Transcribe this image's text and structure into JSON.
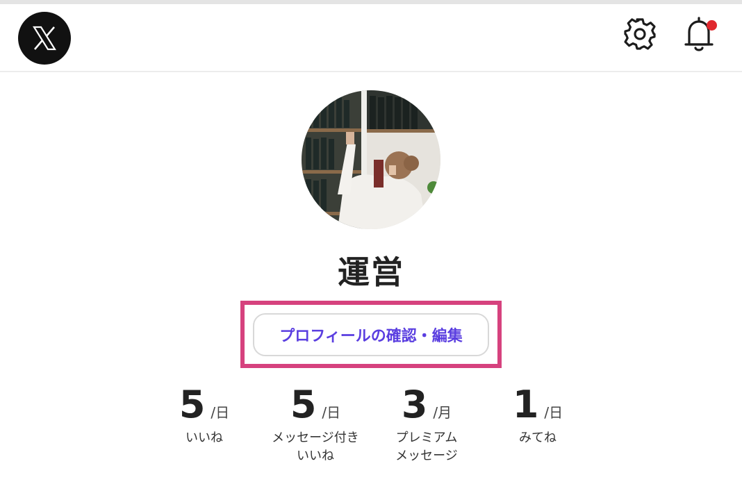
{
  "header": {
    "logo_icon": "x-logo-icon",
    "settings_icon": "gear-icon",
    "notifications_icon": "bell-icon",
    "notification_dot_color": "#e0282e"
  },
  "profile": {
    "name": "運営",
    "edit_button_label": "プロフィールの確認・編集",
    "highlight_color": "#d6427e",
    "edit_button_color": "#5a3ee0"
  },
  "stats": [
    {
      "value": "5",
      "unit": "/日",
      "label_line1": "いいね",
      "label_line2": ""
    },
    {
      "value": "5",
      "unit": "/日",
      "label_line1": "メッセージ付き",
      "label_line2": "いいね"
    },
    {
      "value": "3",
      "unit": "/月",
      "label_line1": "プレミアム",
      "label_line2": "メッセージ"
    },
    {
      "value": "1",
      "unit": "/日",
      "label_line1": "みてね",
      "label_line2": ""
    }
  ]
}
